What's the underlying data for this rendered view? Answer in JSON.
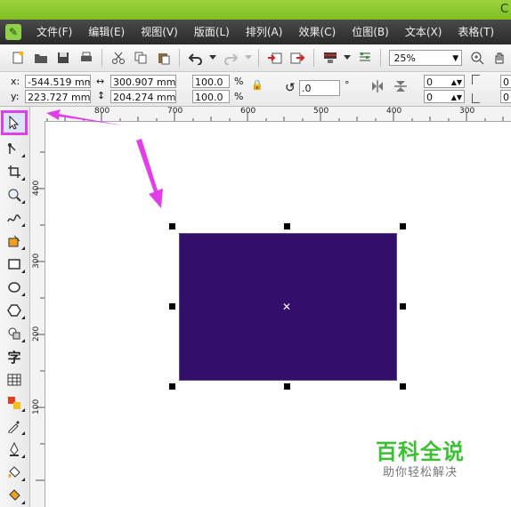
{
  "title_bar": {
    "cut_text": "C"
  },
  "menu": {
    "items": [
      "文件(F)",
      "编辑(E)",
      "视图(V)",
      "版面(L)",
      "排列(A)",
      "效果(C)",
      "位图(B)",
      "文本(X)",
      "表格(T)"
    ]
  },
  "toolbar": {
    "zoom_value": "25%",
    "icons": [
      "new-document-icon",
      "open-folder-icon",
      "save-icon",
      "print-icon",
      "cut-icon",
      "copy-icon",
      "paste-icon",
      "undo-icon",
      "redo-icon",
      "import-icon",
      "export-icon",
      "launcher-icon",
      "options-icon"
    ]
  },
  "property_bar": {
    "x_label": "x:",
    "x_value": "-544.519 mm",
    "y_label": "y:",
    "y_value": "223.727 mm",
    "width_value": "300.907 mm",
    "height_value": "204.274 mm",
    "scale_x": "100.0",
    "scale_y": "100.0",
    "percent_1": "%",
    "percent_2": "%",
    "rotation_value": ".0",
    "degree": "°",
    "pos_a": "0",
    "pos_b": "0"
  },
  "rulers": {
    "top_labels": [
      "800",
      "700",
      "600",
      "500",
      "400",
      "300"
    ],
    "left_labels": [
      "400",
      "300",
      "200",
      "100"
    ]
  },
  "toolbox": {
    "tools": [
      "pick-tool-icon",
      "shape-tool-icon",
      "crop-tool-icon",
      "zoom-tool-icon",
      "freehand-tool-icon",
      "smart-fill-icon",
      "rectangle-tool-icon",
      "ellipse-tool-icon",
      "polygon-tool-icon",
      "basic-shapes-icon",
      "text-tool-icon",
      "table-tool-icon",
      "blend-tool-icon",
      "eyedropper-icon",
      "outline-pen-icon",
      "fill-tool-icon",
      "interactive-fill-icon"
    ]
  },
  "canvas": {
    "shape_fill": "#330e6b",
    "accent_color": "#e23ee8"
  },
  "watermark": {
    "title": "百科全说",
    "subtitle": "助你轻松解决"
  }
}
